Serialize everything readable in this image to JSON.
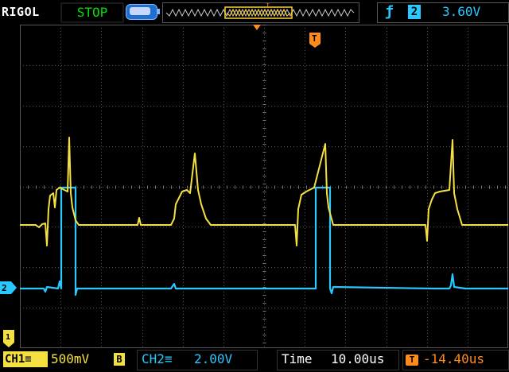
{
  "header": {
    "brand": "RIGOL",
    "run_state": "STOP",
    "trigger_source": "2",
    "trigger_edge_icon": "rising-edge-icon",
    "trigger_level": "3.60V",
    "trigger_marker": "T"
  },
  "colors": {
    "ch1": "#f5e042",
    "ch2": "#29c8ff",
    "trigger": "#ff8c1a",
    "run_state": "#00e000",
    "grid": "#555555"
  },
  "footer": {
    "ch1_label": "CH1",
    "ch1_scale": "500mV",
    "ch1_bw_limit": "B",
    "ch2_label": "CH2",
    "ch2_scale": "2.00V",
    "time_label": "Time",
    "time_scale": "10.00us",
    "trigger_offset": "-14.40us"
  },
  "markers": {
    "ch2_ground": "2",
    "ch1_ground": "1"
  }
}
